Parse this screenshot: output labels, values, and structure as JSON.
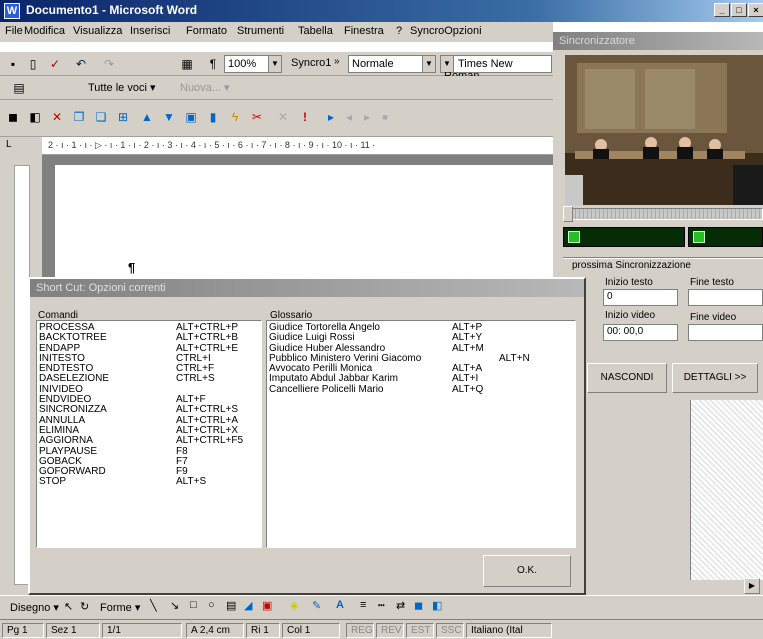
{
  "window": {
    "title": "Documento1 - Microsoft Word",
    "icon": "W"
  },
  "menu": [
    "File",
    "Modifica",
    "Visualizza",
    "Inserisci",
    "Formato",
    "Strumenti",
    "Tabella",
    "Finestra",
    "?",
    "SyncroOpzioni"
  ],
  "toolbar1": {
    "zoom": "100%",
    "macro": "Syncro1",
    "style": "Normale",
    "font": "Times New Roman"
  },
  "toolbar2": {
    "entries": "Tutte le voci",
    "new_label": "Nuova..."
  },
  "ruler": {
    "marks": "2 · ı · 1 · ı · ▷ · ı · 1 · ı · 2 · ı · 3 · ı · 4 · ı · 5 · ı · 6 · ı · 7 · ı · 8 · ı · 9 · ı · 10 · ı · 11 ·"
  },
  "document": {
    "paragraph_mark": "¶"
  },
  "sync": {
    "title": "Sincronizzatore",
    "next_sync": "prossima Sincronizzazione",
    "inizio_testo_label": "Inizio testo",
    "inizio_testo_value": "0",
    "fine_testo_label": "Fine testo",
    "inizio_video_label": "Inizio video",
    "inizio_video_value": "00: 00,0",
    "fine_video_label": "Fine video",
    "hide_button": "NASCONDI",
    "details_button": "DETTAGLI >>"
  },
  "dialog": {
    "title": "Short Cut: Opzioni correnti",
    "commands_label": "Comandi",
    "glossary_label": "Glossario",
    "ok_label": "O.K.",
    "commands": [
      {
        "name": "PROCESSA",
        "key": "ALT+CTRL+P"
      },
      {
        "name": "BACKTOTREE",
        "key": "ALT+CTRL+B"
      },
      {
        "name": "ENDAPP",
        "key": "ALT+CTRL+E"
      },
      {
        "name": "INITESTO",
        "key": "CTRL+I"
      },
      {
        "name": "ENDTESTO",
        "key": "CTRL+F"
      },
      {
        "name": "DASELEZIONE",
        "key": "CTRL+S"
      },
      {
        "name": "INIVIDEO",
        "key": ""
      },
      {
        "name": "ENDVIDEO",
        "key": "ALT+F"
      },
      {
        "name": "SINCRONIZZA",
        "key": "ALT+CTRL+S"
      },
      {
        "name": "ANNULLA",
        "key": "ALT+CTRL+A"
      },
      {
        "name": "ELIMINA",
        "key": "ALT+CTRL+X"
      },
      {
        "name": "AGGIORNA",
        "key": "ALT+CTRL+F5"
      },
      {
        "name": "PLAYPAUSE",
        "key": "F8"
      },
      {
        "name": "GOBACK",
        "key": "F7"
      },
      {
        "name": "GOFORWARD",
        "key": "F9"
      },
      {
        "name": "STOP",
        "key": "ALT+S"
      }
    ],
    "glossary": [
      {
        "name": "Giudice Tortorella Angelo",
        "key": "ALT+P"
      },
      {
        "name": "Giudice Luigi Rossi",
        "key": "ALT+Y"
      },
      {
        "name": "Giudice Huber Alessandro",
        "key": "ALT+M"
      },
      {
        "name": "Pubblico Ministero Verini Giacomo",
        "key": "ALT+N"
      },
      {
        "name": "Avvocato Perilli Monica",
        "key": "ALT+A"
      },
      {
        "name": "Imputato Abdul Jabbar Karim",
        "key": "ALT+I"
      },
      {
        "name": "Cancelliere Policelli Mario",
        "key": "ALT+Q"
      }
    ]
  },
  "drawbar": {
    "draw_label": "Disegno",
    "shapes_label": "Forme"
  },
  "status": {
    "page": "Pg 1",
    "section": "Sez 1",
    "pages": "1/1",
    "pos": "A 2,4 cm",
    "line": "Ri 1",
    "col": "Col 1",
    "reg": "REG",
    "rev": "REV",
    "est": "EST",
    "ssc": "SSC",
    "lang": "Italiano (Ital"
  }
}
